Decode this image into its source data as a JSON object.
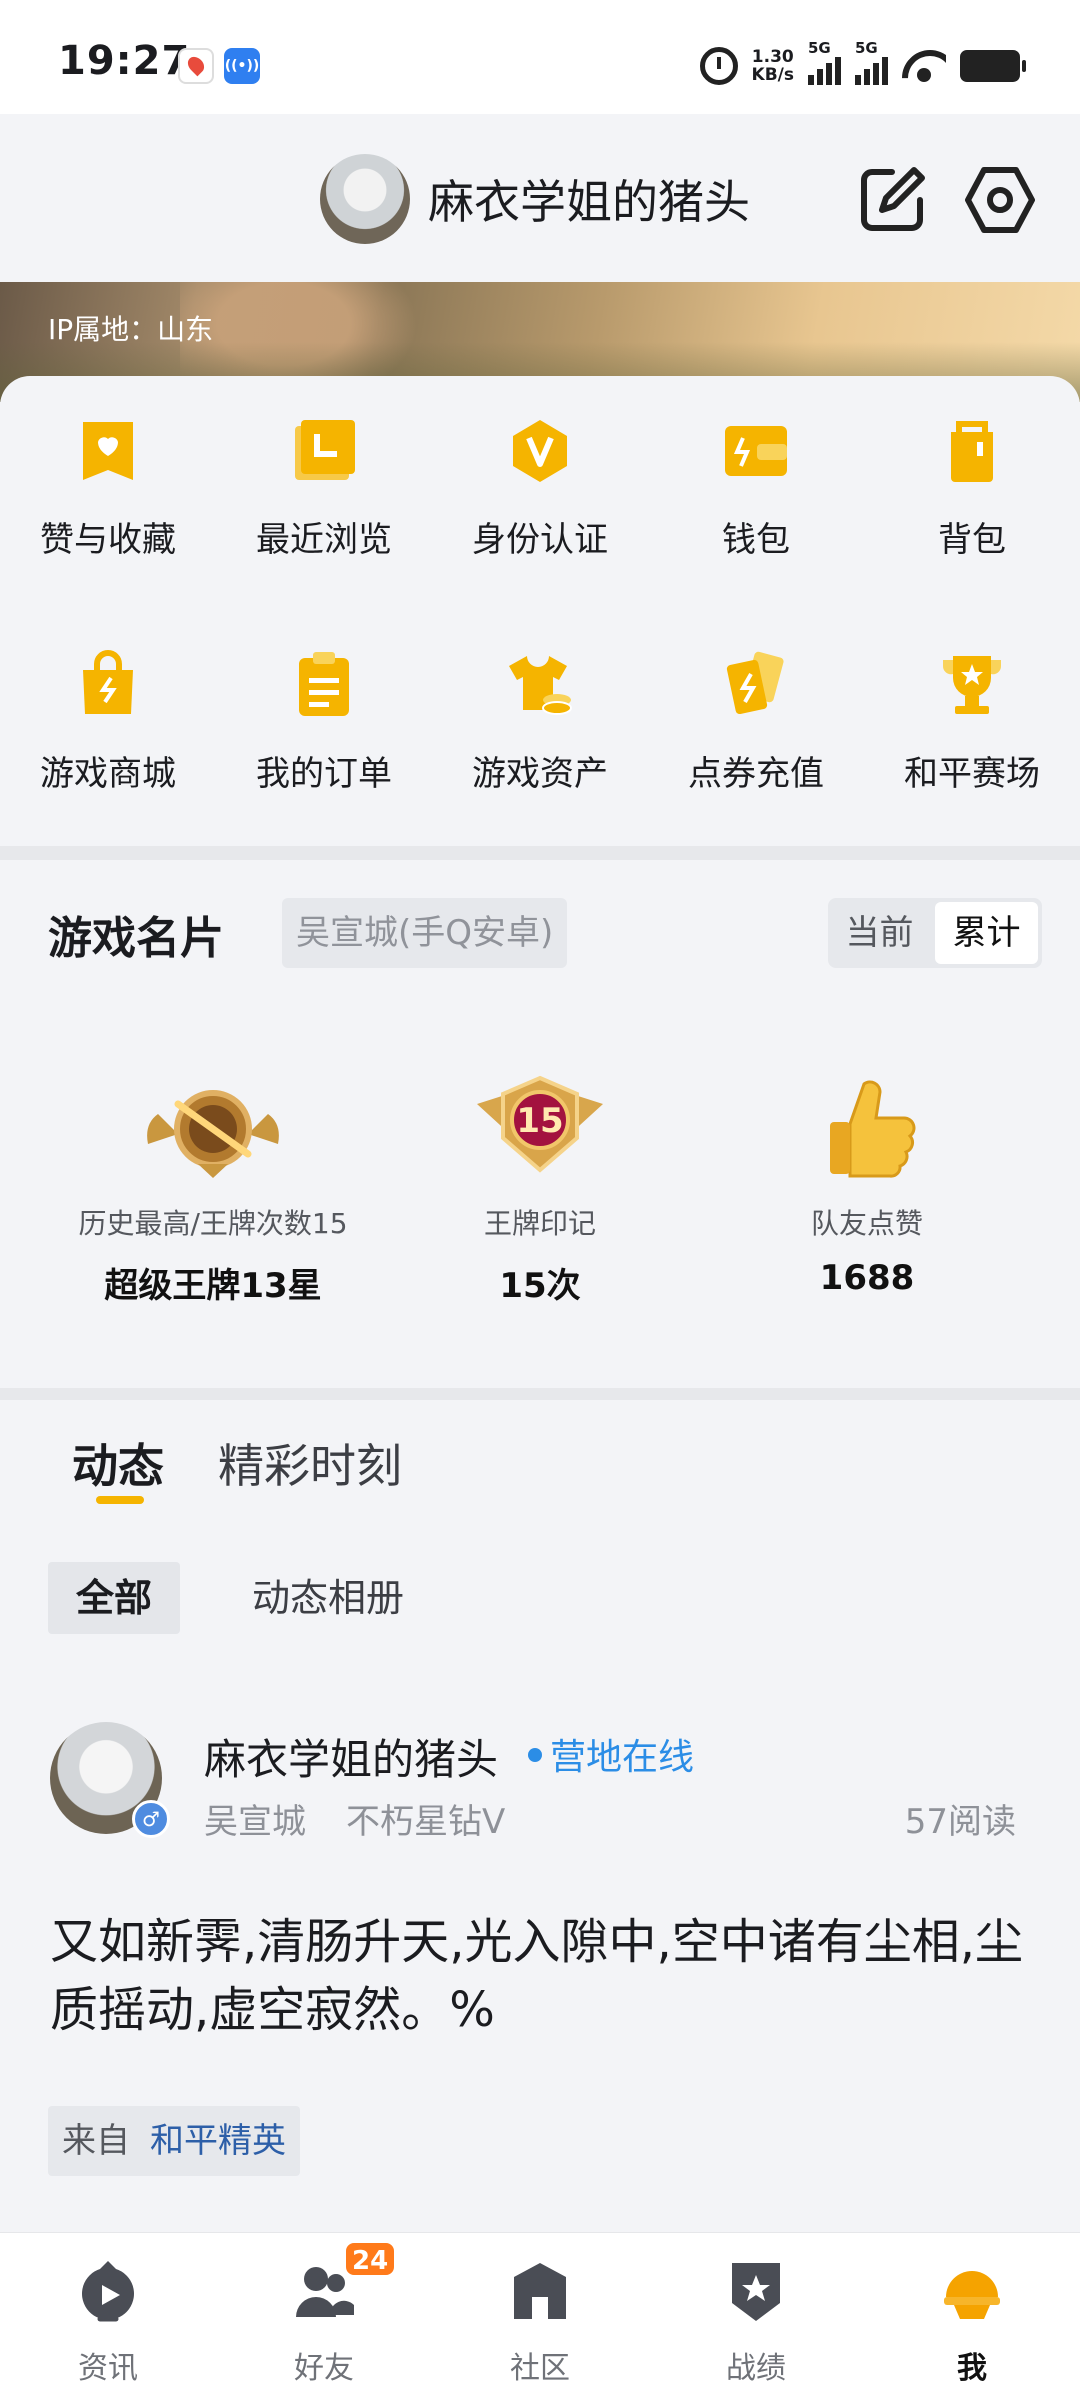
{
  "status_bar": {
    "time": "19:27",
    "speed_value": "1.30",
    "speed_unit": "KB/s",
    "net1": "5G",
    "net2": "5G",
    "icons": [
      "map-notification-icon",
      "broadcast-notification-icon",
      "alarm-icon",
      "signal-icon",
      "wifi-icon",
      "battery-icon"
    ]
  },
  "header": {
    "username": "麻衣学姐的猪头",
    "edit_icon": "edit-icon",
    "settings_icon": "settings-icon"
  },
  "banner": {
    "ip_location": "IP属地：山东"
  },
  "menu": {
    "accent_color": "#f5b400",
    "items": [
      {
        "label": "赞与收藏",
        "icon": "like-collect-icon"
      },
      {
        "label": "最近浏览",
        "icon": "recent-icon"
      },
      {
        "label": "身份认证",
        "icon": "verify-icon"
      },
      {
        "label": "钱包",
        "icon": "wallet-icon"
      },
      {
        "label": "背包",
        "icon": "backpack-icon"
      },
      {
        "label": "游戏商城",
        "icon": "shop-bag-icon"
      },
      {
        "label": "我的订单",
        "icon": "order-icon"
      },
      {
        "label": "游戏资产",
        "icon": "asset-shirt-icon"
      },
      {
        "label": "点券充值",
        "icon": "coupon-cards-icon"
      },
      {
        "label": "和平赛场",
        "icon": "trophy-icon"
      }
    ]
  },
  "game_card": {
    "title": "游戏名片",
    "server": "吴宣城(手Q安卓)",
    "toggle_current": "当前",
    "toggle_total": "累计",
    "stats": [
      {
        "label": "历史最高/王牌次数15",
        "value": "超级王牌13星",
        "icon": "ace-rank-badge-icon"
      },
      {
        "label": "王牌印记",
        "value": "15次",
        "icon": "ace-mark-badge-icon",
        "badge_number": "15"
      },
      {
        "label": "队友点赞",
        "value": "1688",
        "icon": "thumbs-up-icon"
      }
    ]
  },
  "feed": {
    "tabs": [
      "动态",
      "精彩时刻"
    ],
    "filter_all": "全部",
    "filter_album": "动态相册",
    "post": {
      "author": "麻衣学姐的猪头",
      "gender_symbol": "♂",
      "status": "营地在线",
      "server": "吴宣城",
      "rank": "不朽星钻Ⅴ",
      "reads": "57阅读",
      "text": "又如新霁,清肠升天,光入隙中,空中诸有尘相,尘质摇动,虚空寂然。%",
      "source_prefix": "来自",
      "source_game": "和平精英"
    }
  },
  "bottom_nav": {
    "items": [
      {
        "label": "资讯",
        "icon": "news-play-icon"
      },
      {
        "label": "好友",
        "icon": "friends-icon",
        "badge": "24"
      },
      {
        "label": "社区",
        "icon": "community-house-icon"
      },
      {
        "label": "战绩",
        "icon": "record-shield-icon"
      },
      {
        "label": "我",
        "icon": "me-helmet-icon",
        "active": true
      }
    ]
  }
}
